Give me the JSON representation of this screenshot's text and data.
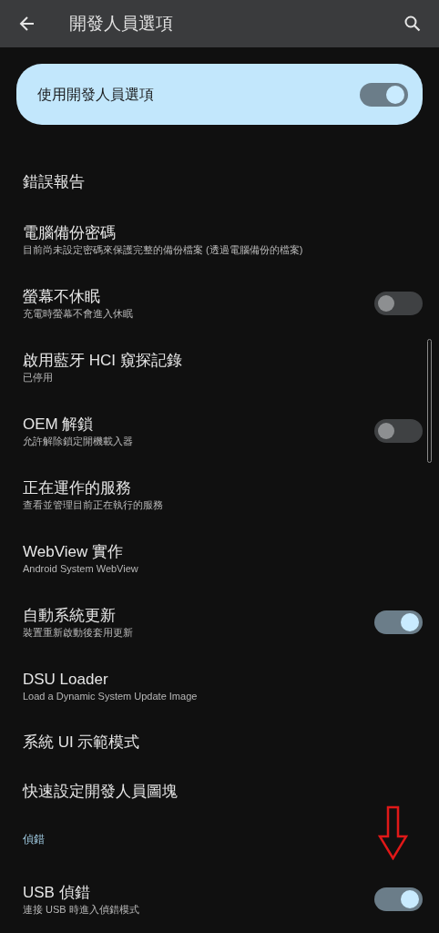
{
  "app_bar": {
    "title": "開發人員選項"
  },
  "main_switch": {
    "label": "使用開發人員選項",
    "on": true
  },
  "items": [
    {
      "kind": "row",
      "title": "錯誤報告"
    },
    {
      "kind": "row",
      "title": "電腦備份密碼",
      "subtitle": "目前尚未設定密碼來保護完整的備份檔案 (透過電腦備份的檔案)"
    },
    {
      "kind": "switch",
      "title": "螢幕不休眠",
      "subtitle": "充電時螢幕不會進入休眠",
      "on": false
    },
    {
      "kind": "row",
      "title": "啟用藍牙 HCI 窺探記錄",
      "subtitle": "已停用"
    },
    {
      "kind": "switch",
      "title": "OEM 解鎖",
      "subtitle": "允許解除鎖定開機載入器",
      "on": false
    },
    {
      "kind": "row",
      "title": "正在運作的服務",
      "subtitle": "查看並管理目前正在執行的服務"
    },
    {
      "kind": "row",
      "title": "WebView 實作",
      "subtitle": "Android System WebView"
    },
    {
      "kind": "switch",
      "title": "自動系統更新",
      "subtitle": "裝置重新啟動後套用更新",
      "on": true
    },
    {
      "kind": "row",
      "title": "DSU Loader",
      "subtitle": "Load a Dynamic System Update Image"
    },
    {
      "kind": "row",
      "title": "系統 UI 示範模式"
    },
    {
      "kind": "row",
      "title": "快速設定開發人員圖塊"
    },
    {
      "kind": "header",
      "title": "偵錯"
    },
    {
      "kind": "switch",
      "title": "USB 偵錯",
      "subtitle": "連接 USB 時進入偵錯模式",
      "on": true
    }
  ]
}
